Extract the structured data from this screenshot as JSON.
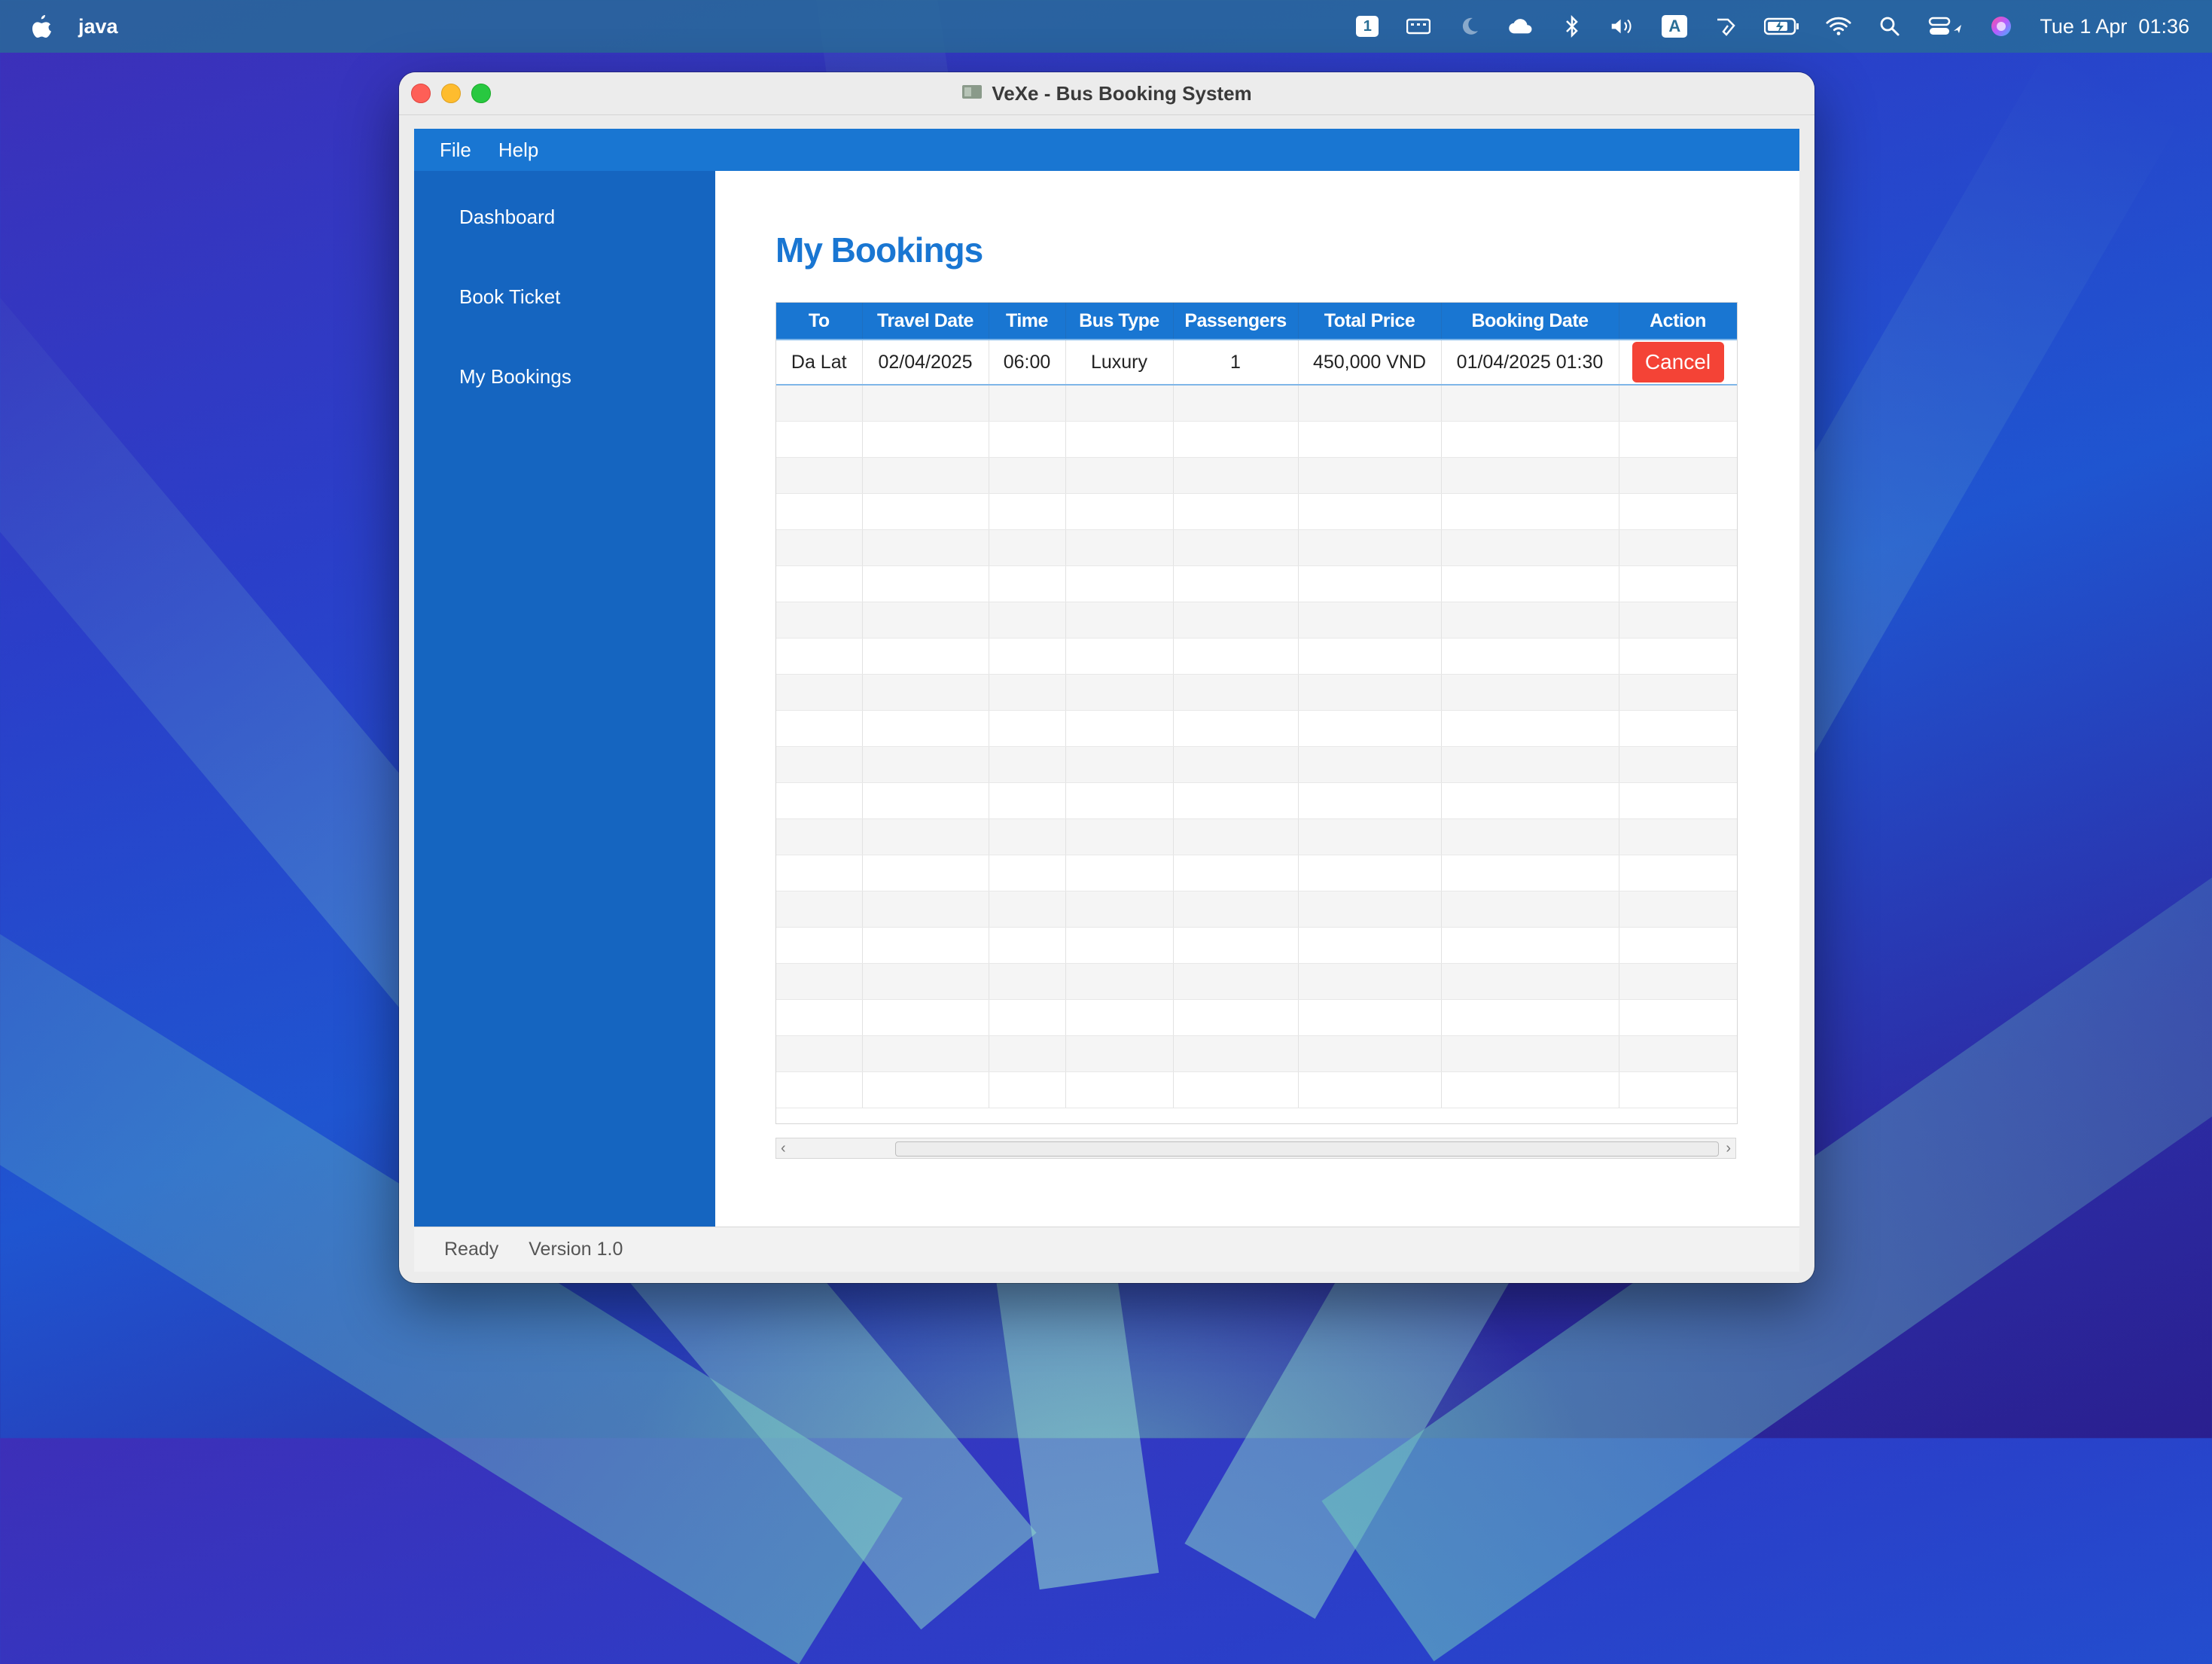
{
  "menubar": {
    "app_name": "java",
    "clock": "Tue 1 Apr  01:36",
    "icons": [
      "apple-icon",
      "desktop-1-icon",
      "keyboard-icon",
      "moon-icon",
      "cloud-icon",
      "bluetooth-icon",
      "volume-icon",
      "input-source-icon",
      "stylus-icon",
      "battery-icon",
      "wifi-icon",
      "search-icon",
      "control-center-icon",
      "siri-icon"
    ],
    "desktop_number": "1",
    "input_source": "A"
  },
  "window": {
    "title": "VeXe - Bus Booking System",
    "menu": [
      "File",
      "Help"
    ]
  },
  "sidebar": {
    "items": [
      "Dashboard",
      "Book Ticket",
      "My Bookings"
    ]
  },
  "main": {
    "title": "My Bookings",
    "table": {
      "columns": [
        "To",
        "Travel Date",
        "Time",
        "Bus Type",
        "Passengers",
        "Total Price",
        "Booking Date",
        "Action"
      ],
      "rows": [
        {
          "to": "Da Lat",
          "travel_date": "02/04/2025",
          "time": "06:00",
          "bus_type": "Luxury",
          "passengers": "1",
          "total_price": "450,000 VND",
          "booking_date": "01/04/2025 01:30",
          "action": "Cancel"
        }
      ]
    }
  },
  "status": {
    "state": "Ready",
    "version": "Version 1.0"
  },
  "colors": {
    "accent": "#1976d2",
    "sidebar": "#1565c0",
    "cancel": "#f44336"
  }
}
